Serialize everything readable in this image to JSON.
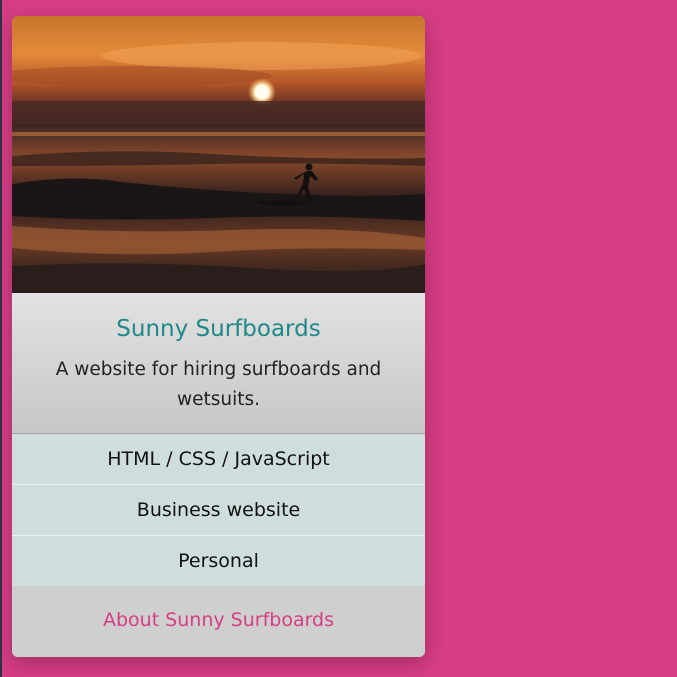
{
  "card": {
    "title": "Sunny Surfboards",
    "description": "A website for hiring surfboards and wetsuits.",
    "tags": [
      "HTML / CSS / JavaScript",
      "Business website",
      "Personal"
    ],
    "link_label": "About Sunny Surfboards"
  },
  "colors": {
    "page_background": "#d63d84",
    "title_color": "#1f8888",
    "link_color": "#d63d84",
    "list_background": "#cfdedd"
  }
}
